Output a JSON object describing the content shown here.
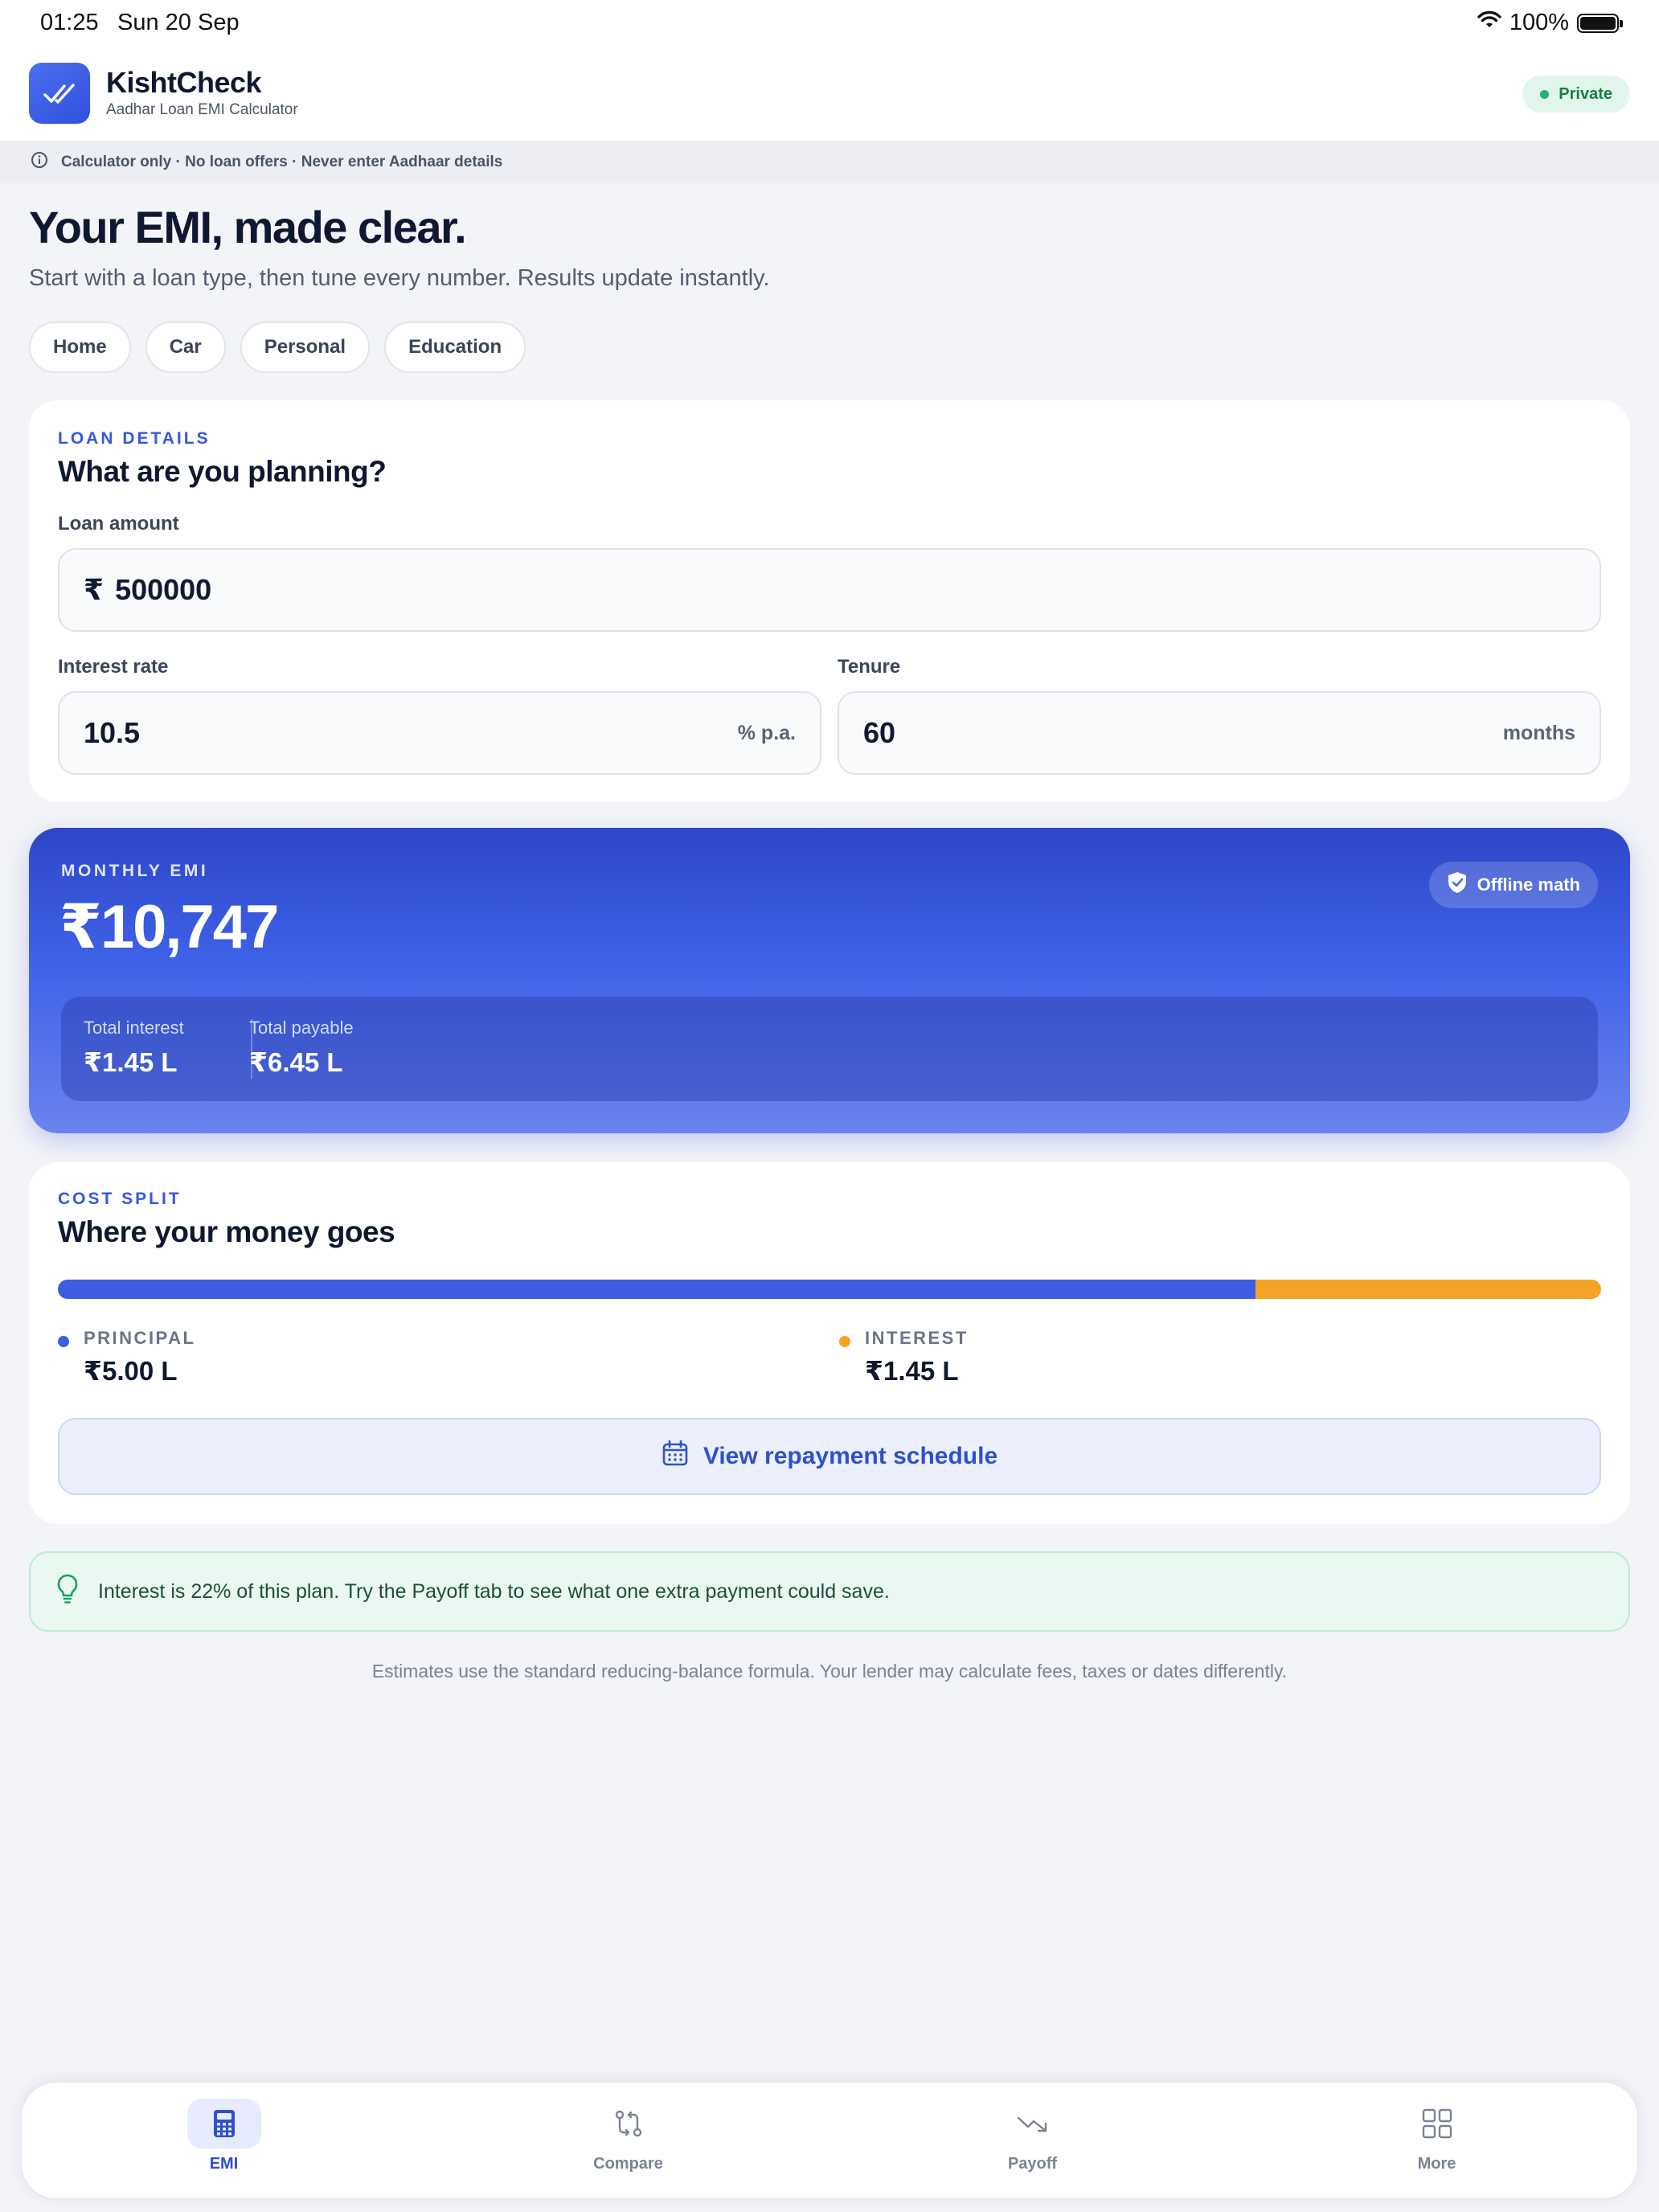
{
  "status_bar": {
    "time": "01:25",
    "date": "Sun 20 Sep",
    "battery": "100%"
  },
  "header": {
    "app_name": "KishtCheck",
    "subtitle": "Aadhar Loan EMI Calculator",
    "badge": "Private"
  },
  "notice": "Calculator only · No loan offers · Never enter Aadhaar details",
  "intro": {
    "title": "Your EMI, made clear.",
    "subtitle": "Start with a loan type, then tune every number. Results update instantly.",
    "loan_types": [
      "Home",
      "Car",
      "Personal",
      "Education"
    ]
  },
  "loan_details": {
    "eyebrow": "LOAN DETAILS",
    "title": "What are you planning?",
    "amount_label": "Loan amount",
    "currency_symbol": "₹",
    "amount_value": "500000",
    "rate_label": "Interest rate",
    "rate_value": "10.5",
    "rate_unit": "% p.a.",
    "tenure_label": "Tenure",
    "tenure_value": "60",
    "tenure_unit": "months"
  },
  "emi": {
    "eyebrow": "MONTHLY EMI",
    "value": "₹10,747",
    "badge": "Offline math",
    "total_interest_label": "Total interest",
    "total_interest_value": "₹1.45 L",
    "total_payable_label": "Total payable",
    "total_payable_value": "₹6.45 L"
  },
  "cost_split": {
    "eyebrow": "COST SPLIT",
    "title": "Where your money goes",
    "principal_fraction": 0.776,
    "principal_label": "PRINCIPAL",
    "principal_value": "₹5.00 L",
    "interest_label": "INTEREST",
    "interest_value": "₹1.45 L",
    "schedule_button": "View repayment schedule"
  },
  "tip": "Interest is 22% of this plan. Try the Payoff tab to see what one extra payment could save.",
  "disclaimer": "Estimates use the standard reducing-balance formula. Your lender may calculate fees, taxes or dates differently.",
  "nav": [
    {
      "label": "EMI",
      "icon": "calculator-icon",
      "active": true
    },
    {
      "label": "Compare",
      "icon": "compare-arrows-icon",
      "active": false
    },
    {
      "label": "Payoff",
      "icon": "trending-down-icon",
      "active": false
    },
    {
      "label": "More",
      "icon": "grid-icon",
      "active": false
    }
  ],
  "colors": {
    "accent": "#3557e0",
    "principal": "#3f5de3",
    "interest": "#f4a424",
    "success": "#22b573"
  }
}
